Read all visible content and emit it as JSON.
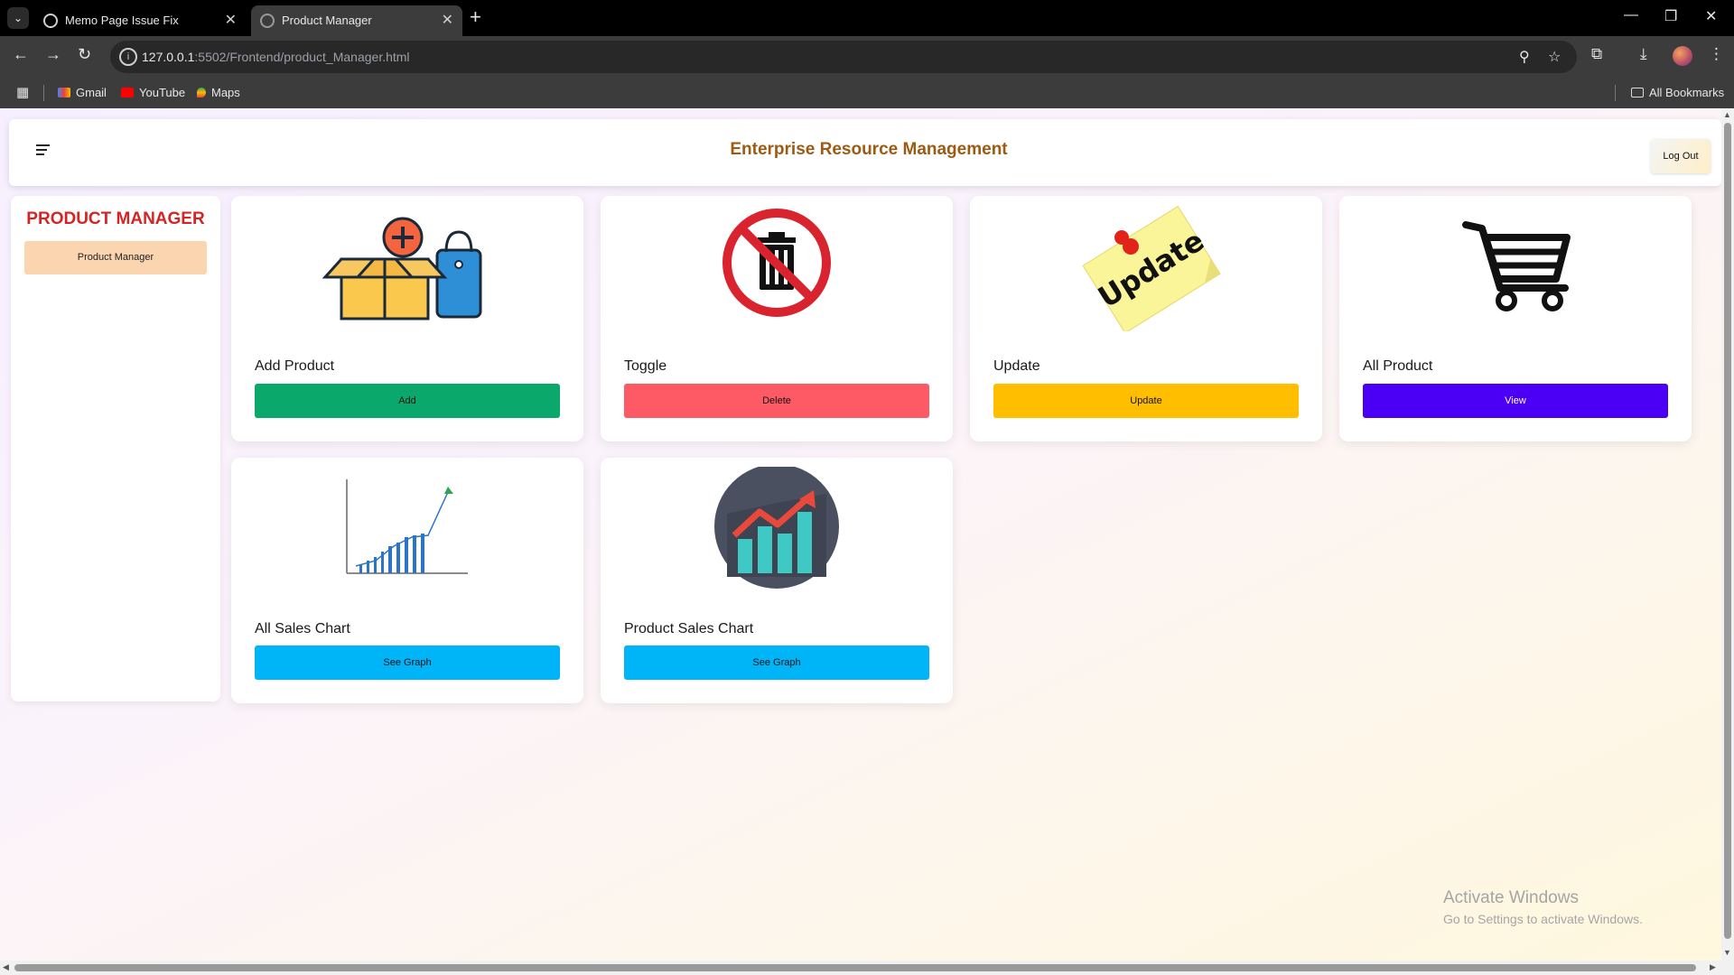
{
  "browser": {
    "tabs": [
      {
        "title": "Memo Page Issue Fix",
        "active": false
      },
      {
        "title": "Product Manager",
        "active": true
      }
    ],
    "url_host": "127.0.0.1",
    "url_rest": ":5502/Frontend/product_Manager.html",
    "bookmarks": [
      {
        "label": "Gmail",
        "icon": "gmail-icon"
      },
      {
        "label": "YouTube",
        "icon": "youtube-icon"
      },
      {
        "label": "Maps",
        "icon": "maps-icon"
      }
    ],
    "all_bookmarks": "All Bookmarks"
  },
  "header": {
    "title": "Enterprise Resource Management",
    "logout_label": "Log Out"
  },
  "sidebar": {
    "title": "PRODUCT MANAGER",
    "items": [
      {
        "label": "Product Manager"
      }
    ]
  },
  "cards": [
    {
      "label": "Add Product",
      "button": "Add",
      "button_color": "#0aa86a",
      "icon": "add-product-box-icon"
    },
    {
      "label": "Toggle",
      "button": "Delete",
      "button_color": "#fe5a66",
      "icon": "no-trash-icon"
    },
    {
      "label": "Update",
      "button": "Update",
      "button_color": "#ffbe00",
      "icon": "update-sticky-note-icon"
    },
    {
      "label": "All Product",
      "button": "View",
      "button_color": "#4b00f5",
      "icon": "shopping-cart-icon"
    },
    {
      "label": "All Sales Chart",
      "button": "See Graph",
      "button_color": "#00b4f8",
      "icon": "sales-line-chart-icon"
    },
    {
      "label": "Product Sales Chart",
      "button": "See Graph",
      "button_color": "#00b4f8",
      "icon": "product-sales-chart-icon"
    }
  ],
  "watermark": {
    "line1": "Activate Windows",
    "line2": "Go to Settings to activate Windows."
  }
}
